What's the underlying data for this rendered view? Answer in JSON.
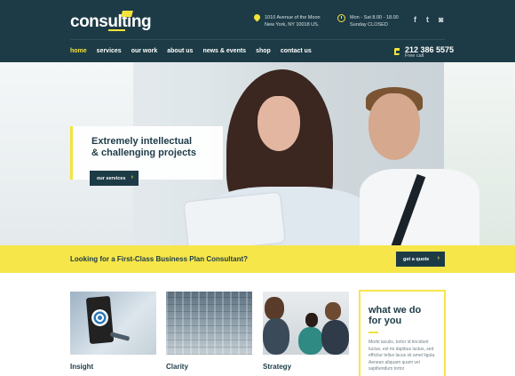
{
  "header": {
    "logo": "consulting",
    "address_line1": "1010 Avenue of the Moon",
    "address_line2": "New York, NY 10018 US.",
    "hours_line1": "Mon - Sat 8.00 - 18.00",
    "hours_line2": "Sunday CLOSED",
    "social": [
      {
        "icon": "facebook-icon",
        "glyph": "f"
      },
      {
        "icon": "twitter-icon",
        "glyph": "t"
      },
      {
        "icon": "instagram-icon",
        "glyph": "◙"
      }
    ],
    "phone": "212 386 5575",
    "phone_sub": "Free call"
  },
  "nav": {
    "items": [
      {
        "label": "home",
        "active": true
      },
      {
        "label": "services"
      },
      {
        "label": "our work"
      },
      {
        "label": "about us"
      },
      {
        "label": "news & events"
      },
      {
        "label": "shop"
      },
      {
        "label": "contact us"
      }
    ]
  },
  "hero": {
    "title_line1": "Extremely intellectual",
    "title_line2": "& challenging projects",
    "button": "our services",
    "arrow": "›"
  },
  "banner": {
    "text": "Looking for a First-Class Business Plan Consultant?",
    "button": "get a quote",
    "arrow": "›"
  },
  "cards": [
    {
      "title": "Insight"
    },
    {
      "title": "Clarity"
    },
    {
      "title": "Strategy"
    }
  ],
  "what_we_do": {
    "title_line1": "what we do",
    "title_line2": "for you",
    "text": "Morbi iaculis, tortor id tincidunt luctus, est mi dapibus luctus, sed efficitur tellus lacus sit amet ligula. Aenean aliquam quam vel sapibendum tortor"
  },
  "colors": {
    "navy": "#1d3b46",
    "accent": "#f4e33b"
  }
}
